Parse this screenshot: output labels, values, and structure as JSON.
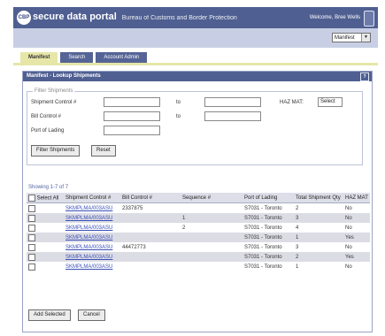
{
  "header": {
    "logo": "CBP",
    "title": "secure data portal",
    "subtitle": "Bureau of Customs and Border Protection",
    "welcome": "Welcome, Bree Wells"
  },
  "subbar": {
    "select_value": "Manifest"
  },
  "tabs": [
    {
      "label": "Manifest",
      "active": true
    },
    {
      "label": "Search"
    },
    {
      "label": "Account Admin"
    }
  ],
  "panel": {
    "title": "Manifest - Lookup Shipments",
    "help": "?",
    "filter": {
      "legend": "Filter Shipments",
      "shipment_label": "Shipment Control #",
      "bill_label": "Bill Control #",
      "port_label": "Port of Lading",
      "to_label": "to",
      "haz_label": "HAZ MAT:",
      "select_value": "Select",
      "filter_button": "Filter Shipments",
      "reset_button": "Reset"
    },
    "showing": "Showing 1-7 of 7"
  },
  "table": {
    "columns": [
      "Select All",
      "Shipment Control #",
      "Bill Control #",
      "Sequence #",
      "Port of Lading",
      "Total Shipment Qty",
      "HAZ MAT"
    ],
    "rows": [
      [
        "",
        "SKMPLMA/003ASU",
        "2337875",
        "",
        "S7031 - Toronto",
        "2",
        "No"
      ],
      [
        "",
        "SKMPLMA/003ASU",
        "",
        "1",
        "S7031 - Toronto",
        "3",
        "No"
      ],
      [
        "",
        "SKMPLMA/003ASU",
        "",
        "2",
        "S7031 - Toronto",
        "4",
        "No"
      ],
      [
        "",
        "SKMPLMA/003ASU",
        "",
        "",
        "S7031 - Toronto",
        "1",
        "Yes"
      ],
      [
        "",
        "SKMPLMA/003ASU",
        "44472773",
        "",
        "S7031 - Toronto",
        "3",
        "No"
      ],
      [
        "",
        "SKMPLMA/003ASU",
        "",
        "",
        "S7031 - Toronto",
        "2",
        "Yes"
      ],
      [
        "",
        "SKMPLMA/003ASU",
        "",
        "",
        "S7031 - Toronto",
        "1",
        "No"
      ]
    ]
  },
  "footer": {
    "add_button": "Add Selected",
    "cancel_button": "Cancel"
  }
}
